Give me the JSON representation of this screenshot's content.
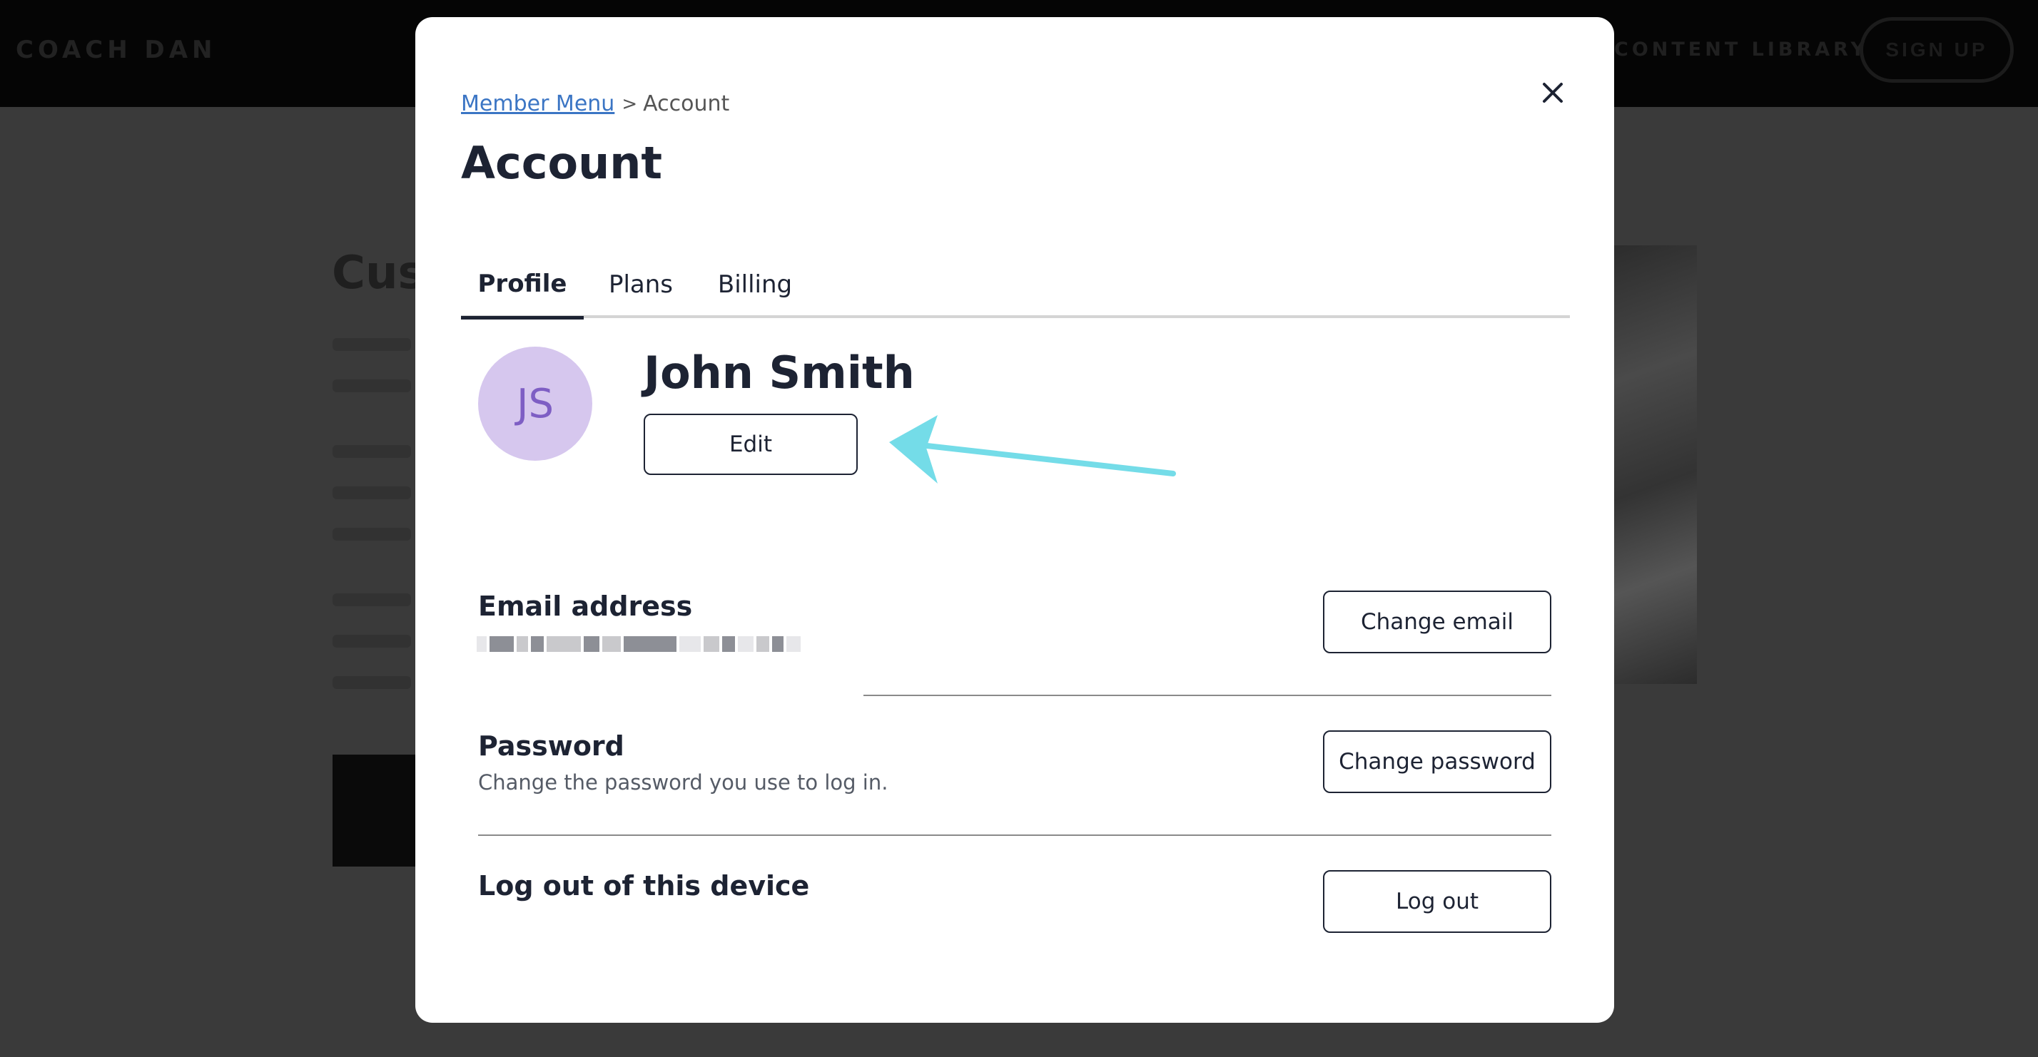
{
  "background": {
    "logo": "COACH DAN",
    "nav_item": "CONTENT LIBRARY",
    "signup_label": "SIGN UP",
    "heading_fragment": "Cust"
  },
  "modal": {
    "breadcrumb": {
      "parent": "Member Menu",
      "separator": ">",
      "current": "Account"
    },
    "title": "Account",
    "tabs": [
      {
        "label": "Profile",
        "active": true
      },
      {
        "label": "Plans",
        "active": false
      },
      {
        "label": "Billing",
        "active": false
      }
    ],
    "profile": {
      "initials": "JS",
      "name": "John Smith",
      "edit_label": "Edit"
    },
    "sections": {
      "email": {
        "title": "Email address",
        "button": "Change email"
      },
      "password": {
        "title": "Password",
        "description": "Change the password you use to log in.",
        "button": "Change password"
      },
      "logout": {
        "title": "Log out of this device",
        "button": "Log out"
      }
    }
  },
  "colors": {
    "accent_link": "#3b75c4",
    "avatar_bg": "#d6c7ee",
    "avatar_text": "#7e5ec4",
    "annotation_arrow": "#74dce8"
  },
  "icons": {
    "close": "close-icon",
    "arrow": "annotation-arrow-icon"
  }
}
